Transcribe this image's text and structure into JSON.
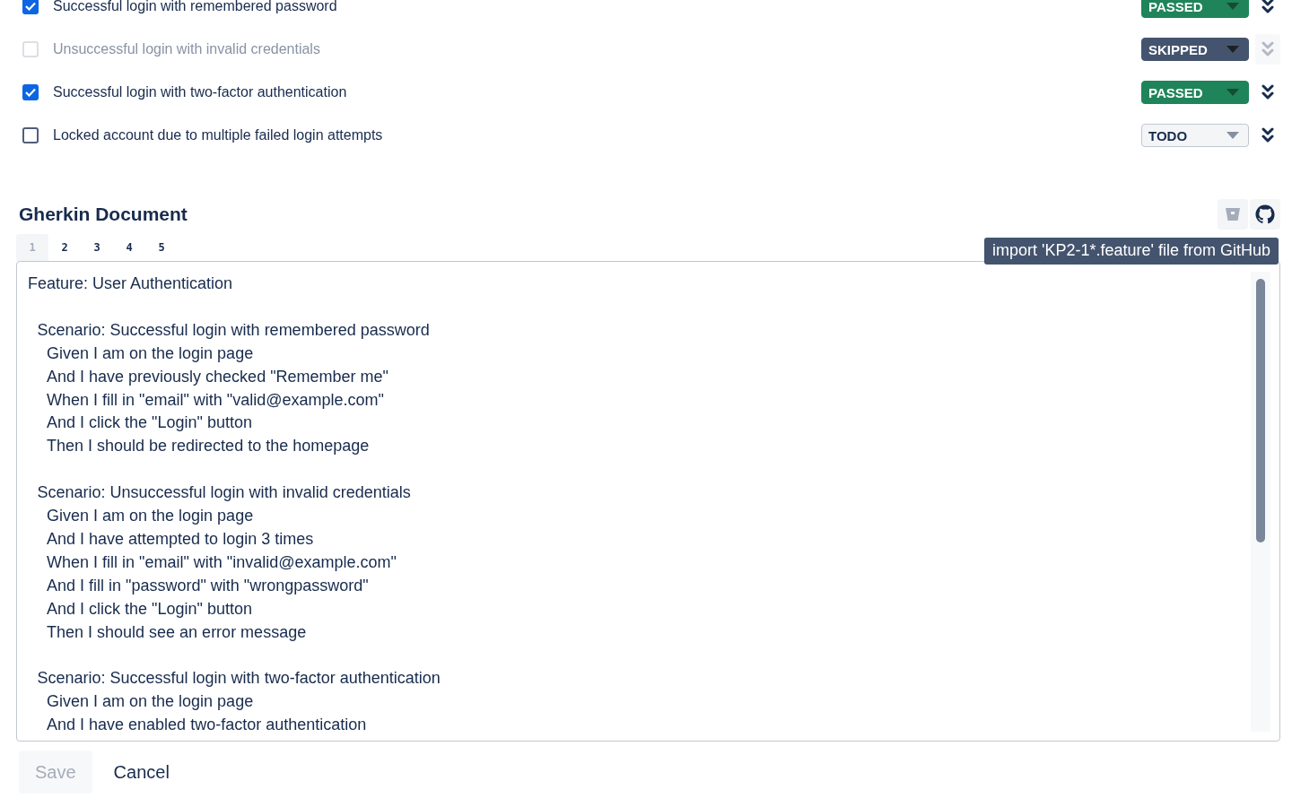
{
  "test_cases": [
    {
      "label": "Successful login with remembered password",
      "checked": true,
      "disabled": false,
      "status": {
        "kind": "passed",
        "label": "PASSED"
      }
    },
    {
      "label": "Unsuccessful login with invalid credentials",
      "checked": false,
      "disabled": true,
      "status": {
        "kind": "skipped",
        "label": "SKIPPED"
      }
    },
    {
      "label": "Successful login with two-factor authentication",
      "checked": true,
      "disabled": false,
      "status": {
        "kind": "passed",
        "label": "PASSED"
      }
    },
    {
      "label": "Locked account due to multiple failed login attempts",
      "checked": false,
      "disabled": false,
      "status": {
        "kind": "todo",
        "label": "TODO"
      }
    }
  ],
  "gherkin": {
    "title": "Gherkin Document",
    "tooltip": "import 'KP2-1*.feature' file from GitHub",
    "tabs": [
      {
        "label": "1",
        "selected": true
      },
      {
        "label": "2",
        "selected": false
      },
      {
        "label": "3",
        "selected": false
      },
      {
        "label": "4",
        "selected": false
      },
      {
        "label": "5",
        "selected": false
      }
    ],
    "editor": {
      "feature": "Feature: User Authentication",
      "scenarios": [
        {
          "title": "Scenario: Successful login with remembered password",
          "steps": [
            "Given I am on the login page",
            "And I have previously checked \"Remember me\"",
            "When I fill in \"email\" with \"valid@example.com\"",
            "And I click the \"Login\" button",
            "Then I should be redirected to the homepage"
          ]
        },
        {
          "title": "Scenario: Unsuccessful login with invalid credentials",
          "steps": [
            "Given I am on the login page",
            "And I have attempted to login 3 times",
            "When I fill in \"email\" with \"invalid@example.com\"",
            "And I fill in \"password\" with \"wrongpassword\"",
            "And I click the \"Login\" button",
            "Then I should see an error message"
          ]
        },
        {
          "title": "Scenario: Successful login with two-factor authentication",
          "steps": [
            "Given I am on the login page",
            "And I have enabled two-factor authentication"
          ]
        }
      ]
    }
  },
  "buttons": {
    "save": {
      "label": "Save",
      "disabled": true
    },
    "cancel": {
      "label": "Cancel"
    }
  }
}
